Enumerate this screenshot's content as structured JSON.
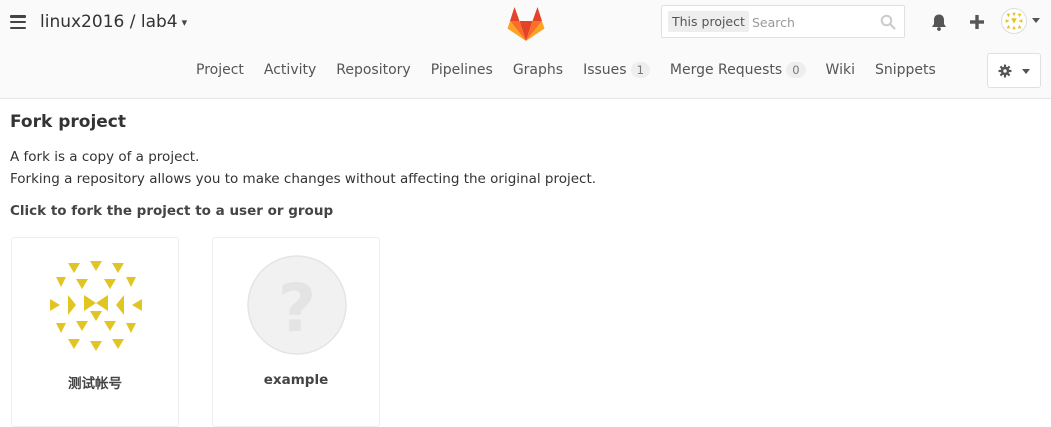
{
  "header": {
    "project_path": "linux2016 / lab4",
    "search": {
      "scope": "This project",
      "placeholder": "Search"
    }
  },
  "nav": {
    "items": [
      {
        "label": "Project"
      },
      {
        "label": "Activity"
      },
      {
        "label": "Repository"
      },
      {
        "label": "Pipelines"
      },
      {
        "label": "Graphs"
      },
      {
        "label": "Issues",
        "badge": "1"
      },
      {
        "label": "Merge Requests",
        "badge": "0"
      },
      {
        "label": "Wiki"
      },
      {
        "label": "Snippets"
      }
    ]
  },
  "page": {
    "title": "Fork project",
    "intro_line1": "A fork is a copy of a project.",
    "intro_line2": "Forking a repository allows you to make changes without affecting the original project.",
    "instruction": "Click to fork the project to a user or group"
  },
  "namespaces": [
    {
      "name": "测试帐号",
      "avatar": "identicon"
    },
    {
      "name": "example",
      "avatar": "question-icon"
    }
  ],
  "colors": {
    "identicon": "#e1c523",
    "gitlab_dark": "#e24329",
    "gitlab_mid": "#fc6d26",
    "gitlab_light": "#fca326",
    "placeholder_avatar": "#f0f0f0"
  }
}
